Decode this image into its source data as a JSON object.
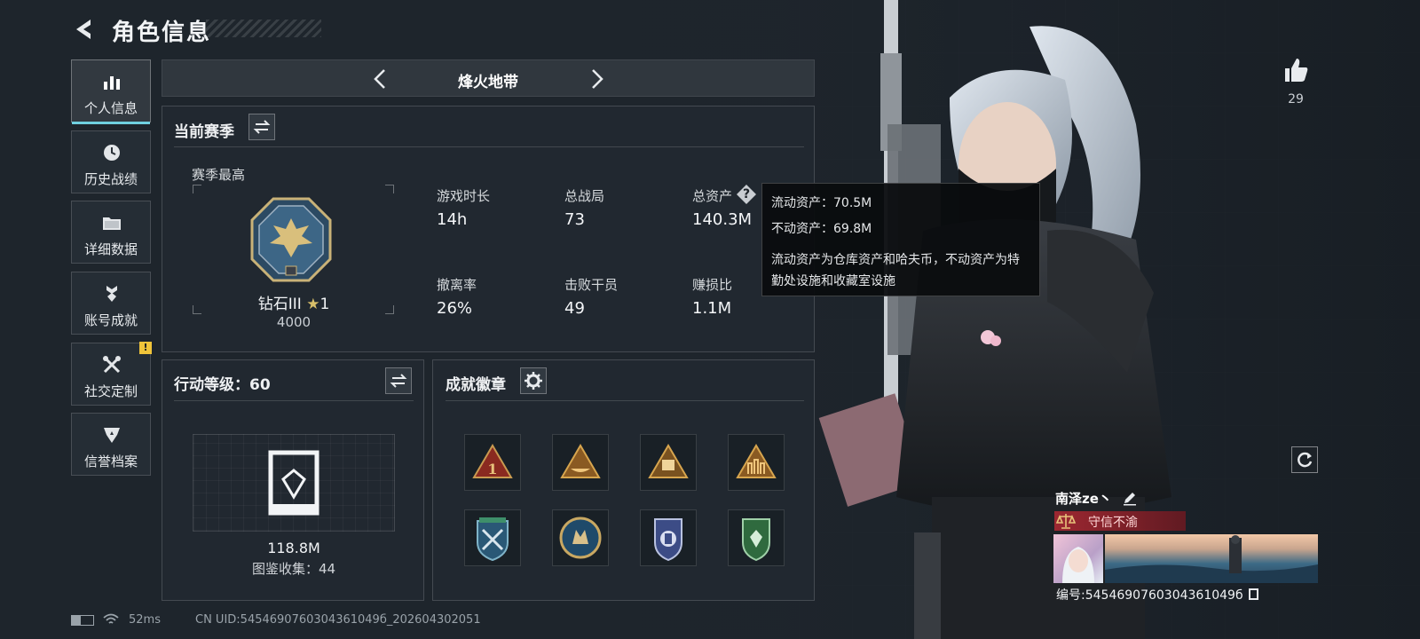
{
  "header": {
    "title": "角色信息"
  },
  "sidebar": {
    "items": [
      {
        "label": "个人信息",
        "icon": "bar-chart-icon",
        "active": true
      },
      {
        "label": "历史战绩",
        "icon": "clock-icon"
      },
      {
        "label": "详细数据",
        "icon": "folder-icon"
      },
      {
        "label": "账号成就",
        "icon": "medal-icon"
      },
      {
        "label": "社交定制",
        "icon": "tools-icon",
        "alert": "!"
      },
      {
        "label": "信誉档案",
        "icon": "shield-icon"
      }
    ]
  },
  "mode": {
    "title": "烽火地带"
  },
  "season": {
    "title": "当前赛季",
    "best_label": "赛季最高",
    "rank_name": "钻石III",
    "rank_stars": "1",
    "rank_score": "4000",
    "stats": [
      {
        "label": "游戏时长",
        "value": "14h"
      },
      {
        "label": "总战局",
        "value": "73"
      },
      {
        "label": "总资产",
        "value": "140.3M",
        "help": "?"
      },
      {
        "label": "撤离率",
        "value": "26%"
      },
      {
        "label": "击败干员",
        "value": "49"
      },
      {
        "label": "赚损比",
        "value": "1.1M"
      }
    ]
  },
  "tooltip": {
    "liquid": "流动资产：70.5M",
    "fixed": "不动资产：69.8M",
    "desc": "流动资产为仓库资产和哈夫币，不动资产为特勤处设施和收藏室设施"
  },
  "action_level": {
    "title": "行动等级：60",
    "value": "118.8M",
    "collection": "图鉴收集：44"
  },
  "achievements": {
    "title": "成就徽章",
    "badges": [
      "triangle-1-badge",
      "triangle-boat-badge",
      "triangle-58-badge",
      "triangle-soldiers-badge",
      "shield-crossed-badge",
      "round-wolf-badge",
      "shield-knight-badge",
      "green-shield-badge"
    ]
  },
  "likes": {
    "count": "29"
  },
  "player": {
    "name": "南泽ze丶",
    "motto": "守信不渝",
    "uid_label": "编号:5454690760304361049б"
  },
  "footer": {
    "ping": "52ms",
    "uid": "CN UID:5454690760304361049б_202604302051"
  },
  "colors": {
    "accent": "#6fd0e0",
    "motto": "#a82832",
    "alert": "#f0c43a"
  }
}
